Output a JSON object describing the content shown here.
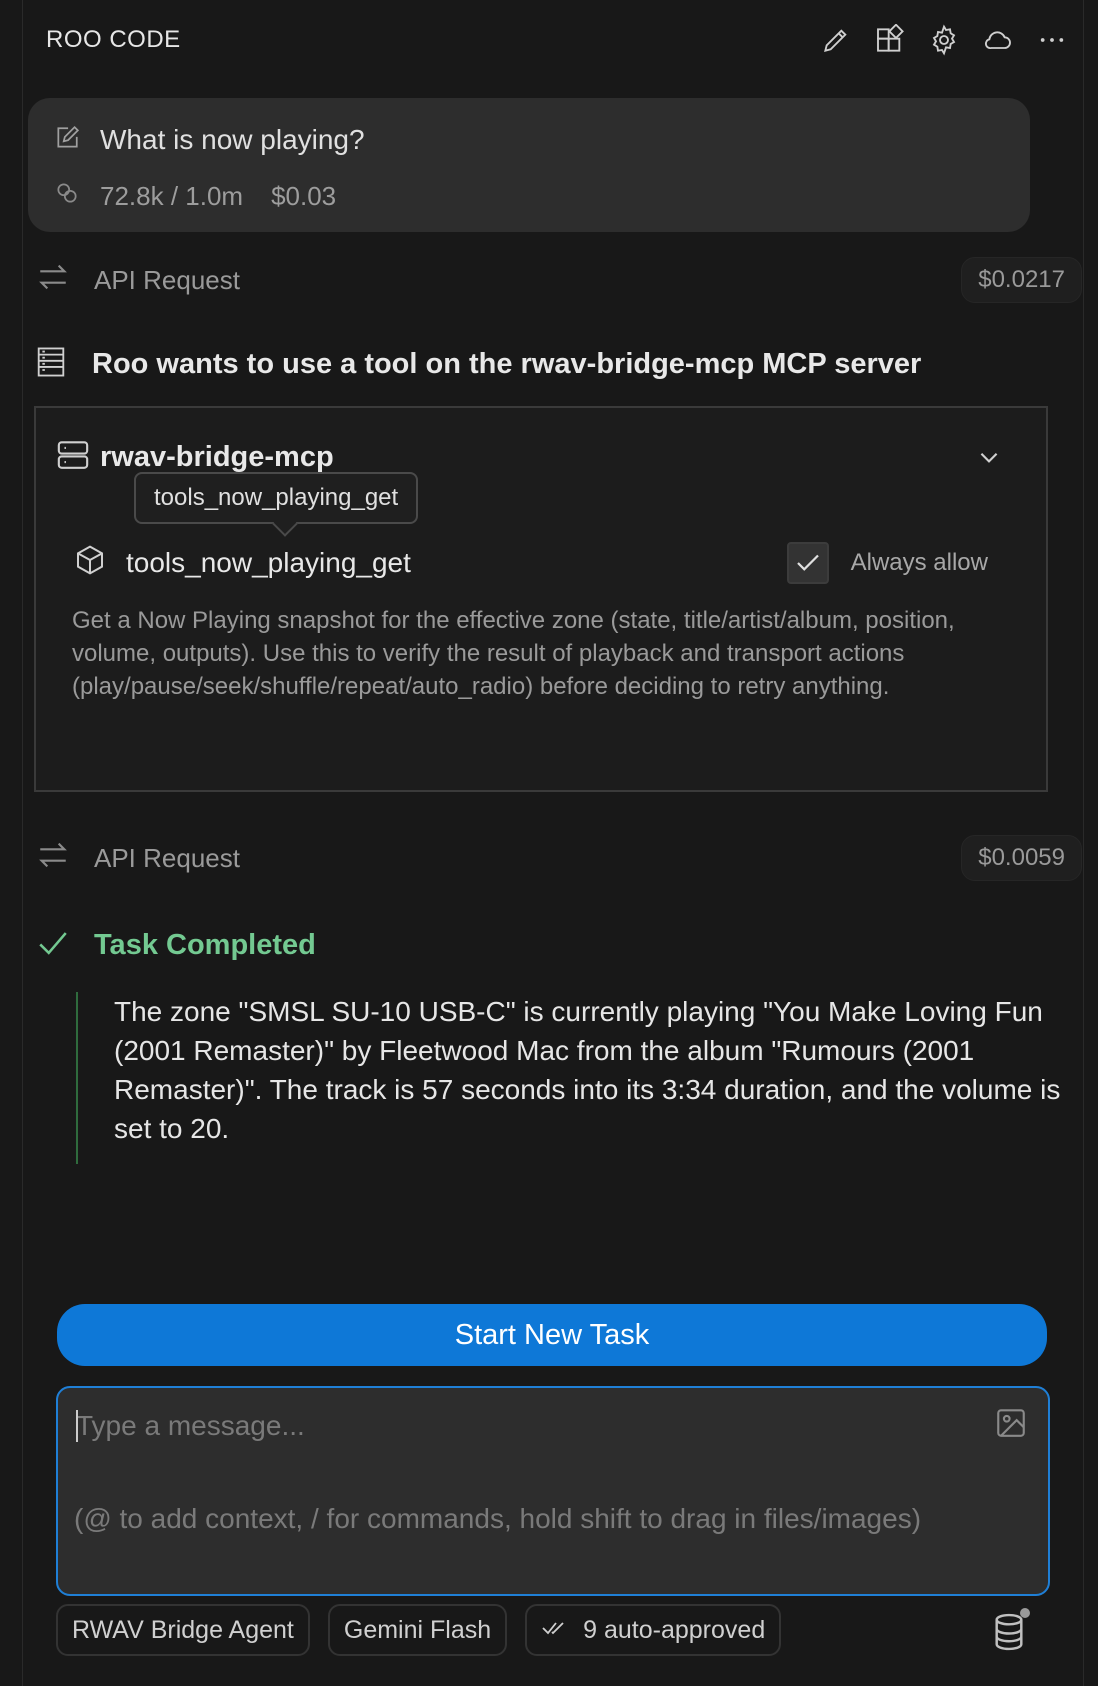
{
  "header": {
    "title": "ROO CODE",
    "icons": [
      "pencil-icon",
      "marketplace-icon",
      "gear-icon",
      "cloud-icon",
      "more-icon"
    ]
  },
  "task": {
    "title": "What is now playing?",
    "tokens": "72.8k / 1.0m",
    "cost": "$0.03"
  },
  "api_requests": [
    {
      "label": "API Request",
      "cost": "$0.0217"
    },
    {
      "label": "API Request",
      "cost": "$0.0059"
    }
  ],
  "tool_use": {
    "header": "Roo wants to use a tool on the rwav-bridge-mcp MCP server",
    "server_name": "rwav-bridge-mcp",
    "tooltip": "tools_now_playing_get",
    "tool_name": "tools_now_playing_get",
    "always_allow_label": "Always allow",
    "always_allow_checked": true,
    "description": "Get a Now Playing snapshot for the effective zone (state, title/artist/album, position, volume, outputs). Use this to verify the result of playback and transport actions (play/pause/seek/shuffle/repeat/auto_radio) before deciding to retry anything."
  },
  "completion": {
    "title": "Task Completed",
    "text": "The zone \"SMSL SU-10 USB-C\" is currently playing \"You Make Loving Fun (2001 Remaster)\" by Fleetwood Mac from the album \"Rumours (2001 Remaster)\". The track is 57 seconds into its 3:34 duration, and the volume is set to 20."
  },
  "start_button": "Start New Task",
  "input": {
    "placeholder": "Type a message...",
    "hint": "(@ to add context, / for commands, hold shift to drag in files/images)"
  },
  "bottom": {
    "mode": "RWAV Bridge Agent",
    "model": "Gemini Flash",
    "auto_approved": "9 auto-approved"
  },
  "colors": {
    "accent": "#0e78d7",
    "success": "#73c991",
    "background": "#181818",
    "card": "#2d2d2d"
  }
}
